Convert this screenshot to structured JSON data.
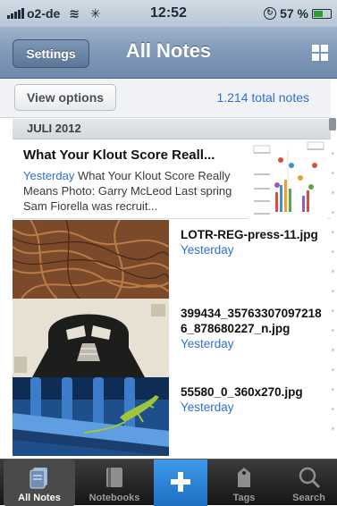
{
  "status_bar": {
    "carrier": "o2-de",
    "time": "12:52",
    "battery": "57 %"
  },
  "nav": {
    "settings_label": "Settings",
    "title": "All Notes"
  },
  "toolbar": {
    "view_options_label": "View options",
    "total_notes": "1.214 total notes"
  },
  "section_header": "JULI 2012",
  "notes": [
    {
      "title": "What Your Klout Score Reall...",
      "date": "Yesterday",
      "snippet": " What Your Klout Score Really Means Photo: Garry McLeod Last spring Sam Fiorella was recruit..."
    },
    {
      "filename": "LOTR-REG-press-11.jpg",
      "date": "Yesterday"
    },
    {
      "filename": "399434_357633070972186_878680227_n.jpg",
      "date": "Yesterday"
    },
    {
      "filename": "55580_0_360x270.jpg",
      "date": "Yesterday"
    }
  ],
  "tabs": {
    "all_notes": "All Notes",
    "notebooks": "Notebooks",
    "tags": "Tags",
    "search": "Search"
  },
  "colors": {
    "accent": "#2f6fd1",
    "nav_bar": "#7f98b7",
    "add_button": "#2a84d8"
  }
}
